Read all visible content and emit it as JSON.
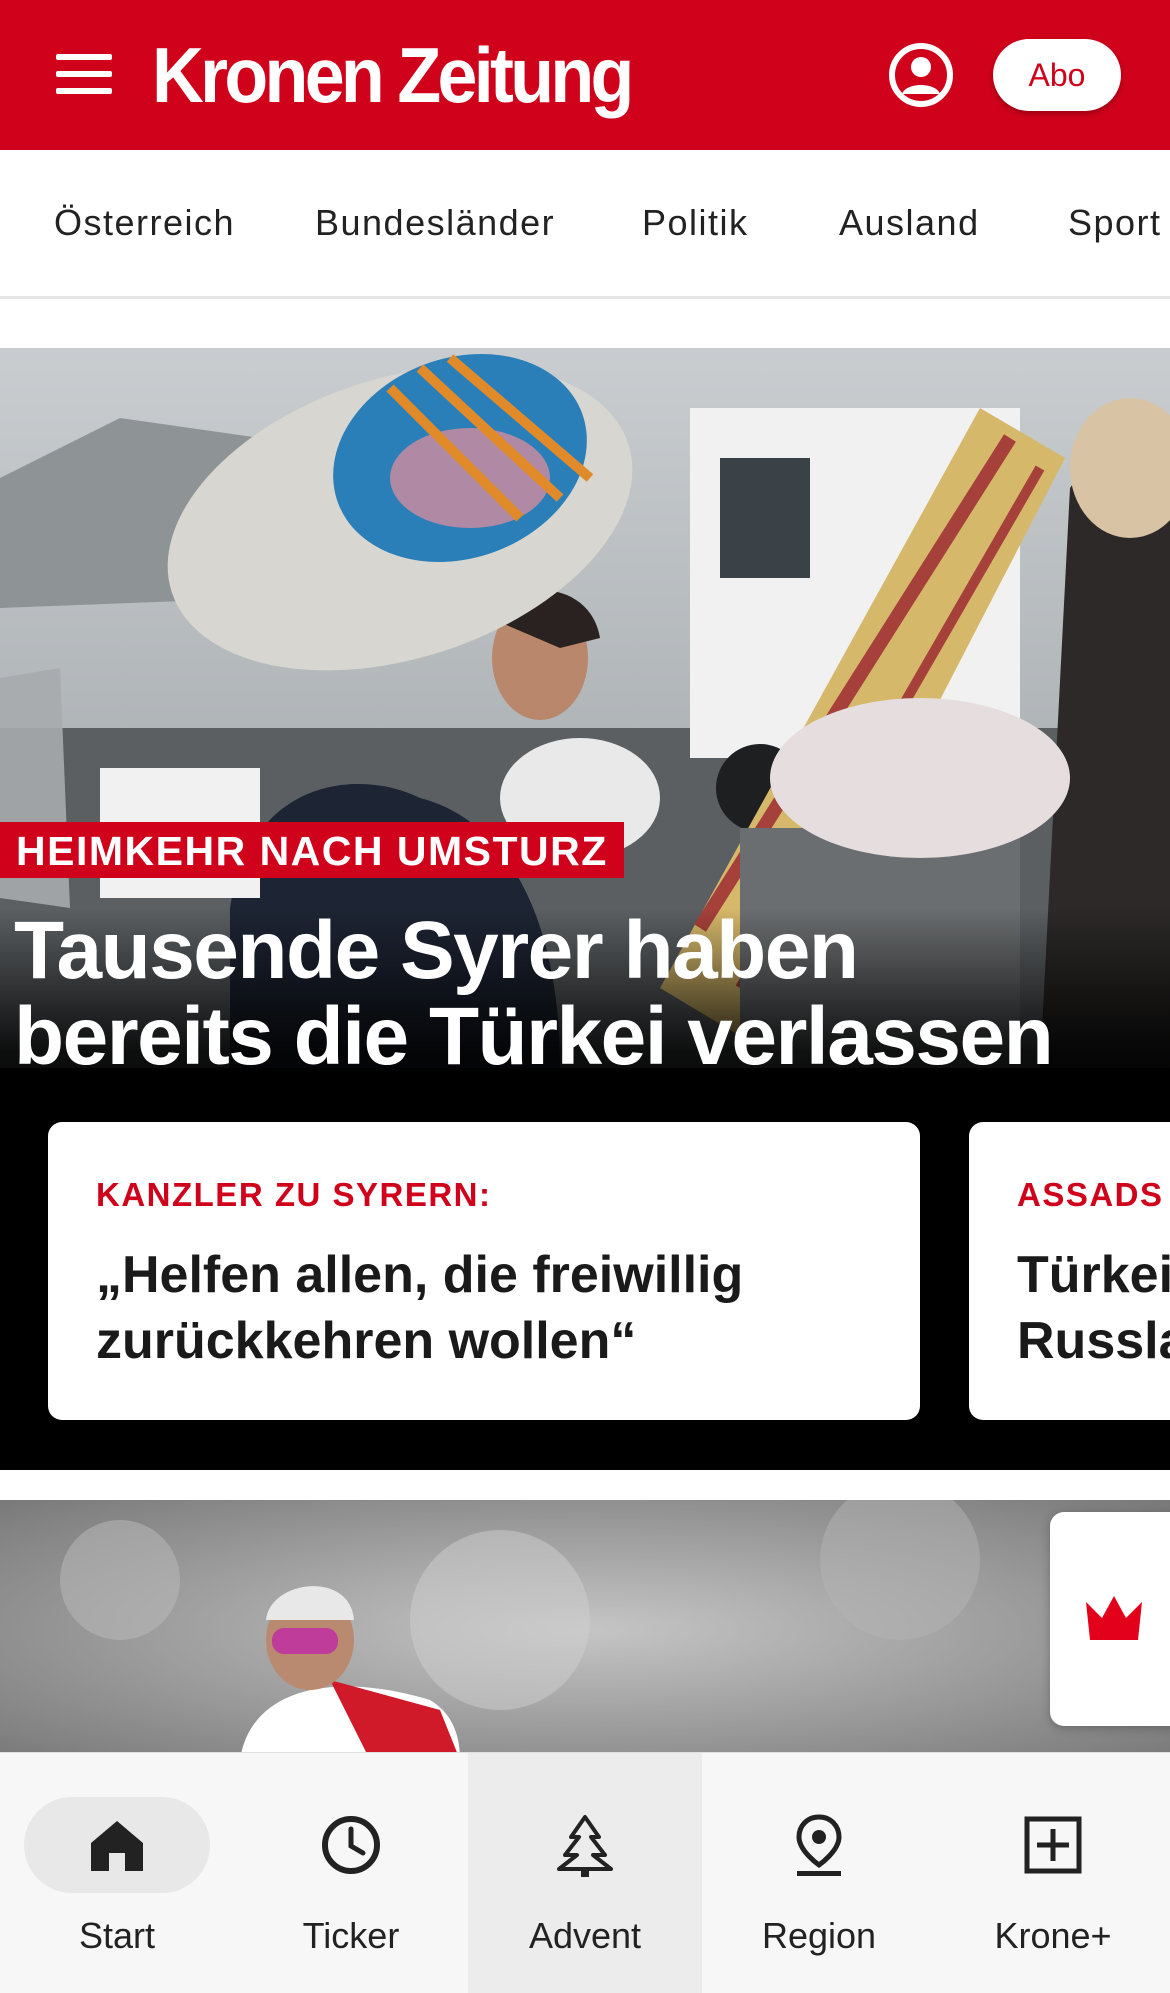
{
  "header": {
    "logo_text": "Kronen Zeitung",
    "abo_label": "Abo",
    "brand_color": "#d0021b"
  },
  "category_nav": {
    "items": [
      {
        "label": "Österreich"
      },
      {
        "label": "Bundesländer"
      },
      {
        "label": "Politik"
      },
      {
        "label": "Ausland"
      },
      {
        "label": "Sport"
      }
    ]
  },
  "hero": {
    "kicker": "HEIMKEHR NACH UMSTURZ",
    "headline": "Tausende Syrer haben bereits die Türkei verlassen",
    "cards": [
      {
        "kicker": "KANZLER ZU SYRERN:",
        "title": "„Helfen allen, die freiwillig\nzurückkehren wollen“"
      },
      {
        "kicker": "ASSADS",
        "title": "Türkei\nRussla"
      }
    ]
  },
  "bottom_nav": {
    "tabs": [
      {
        "label": "Start",
        "icon": "home-icon",
        "active": true
      },
      {
        "label": "Ticker",
        "icon": "clock-icon"
      },
      {
        "label": "Advent",
        "icon": "tree-icon"
      },
      {
        "label": "Region",
        "icon": "location-pin-icon"
      },
      {
        "label": "Krone+",
        "icon": "plus-box-icon"
      }
    ]
  }
}
